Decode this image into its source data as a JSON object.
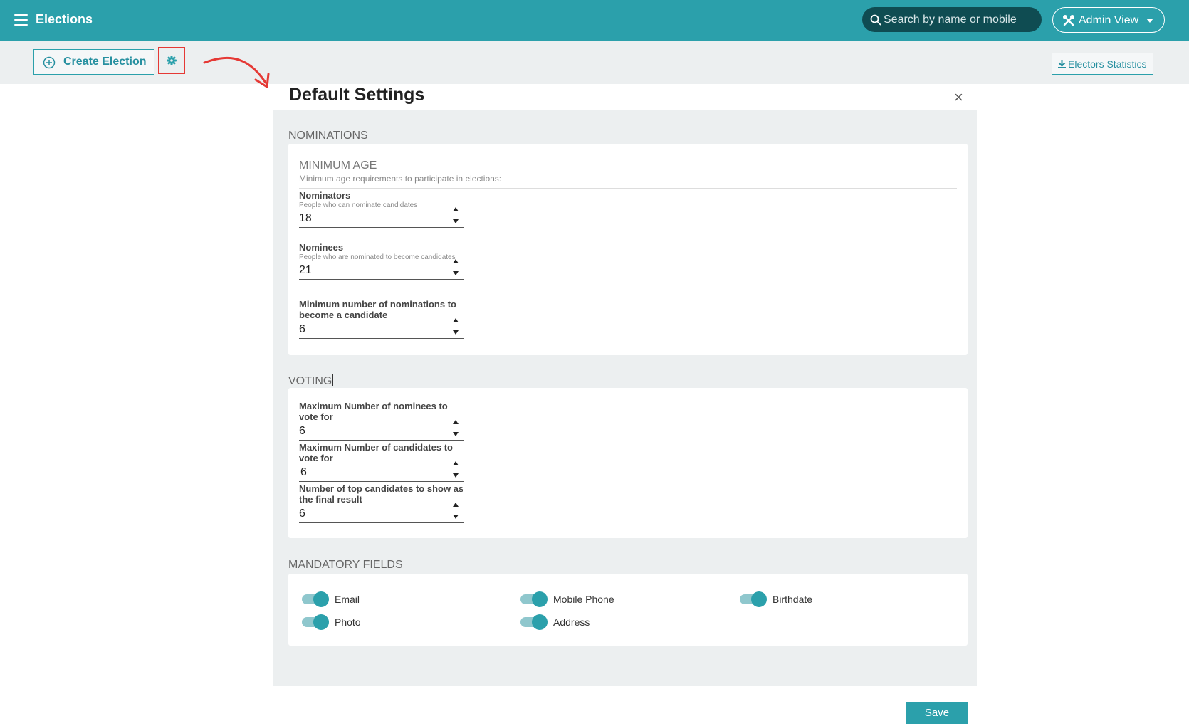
{
  "header": {
    "title": "Elections",
    "search_placeholder": "Search by name or mobile",
    "admin_view_label": "Admin View",
    "bg_color": "#2ba0ab"
  },
  "toolbar": {
    "create_label": "Create Election",
    "stats_label": "Electors Statistics"
  },
  "dialog": {
    "title": "Default Settings",
    "close_symbol": "×",
    "save_label": "Save"
  },
  "nominations": {
    "heading": "NOMINATIONS",
    "min_age_title": "MINIMUM AGE",
    "min_age_desc": "Minimum age requirements to participate in elections:",
    "nominators": {
      "label": "Nominators",
      "hint": "People who can nominate candidates",
      "value": "18"
    },
    "nominees": {
      "label": "Nominees",
      "hint": "People who are nominated to become candidates",
      "value": "21"
    },
    "min_nominations": {
      "label": "Minimum number of nominations to become a candidate",
      "value": "6"
    }
  },
  "voting": {
    "heading": "VOTING",
    "max_nominees": {
      "label": "Maximum Number of nominees to vote for",
      "value": "6"
    },
    "max_candidates": {
      "label": "Maximum Number of candidates to vote for",
      "value": "6"
    },
    "top_candidates": {
      "label": "Number of top candidates to show as the final result",
      "value": "6"
    }
  },
  "mandatory": {
    "heading": "MANDATORY FIELDS",
    "fields": [
      {
        "label": "Email",
        "on": true
      },
      {
        "label": "Mobile Phone",
        "on": true
      },
      {
        "label": "Birthdate",
        "on": true
      },
      {
        "label": "Photo",
        "on": true
      },
      {
        "label": "Address",
        "on": true
      }
    ]
  },
  "colors": {
    "accent": "#2ba0ab",
    "annotation_red": "#e53935"
  }
}
